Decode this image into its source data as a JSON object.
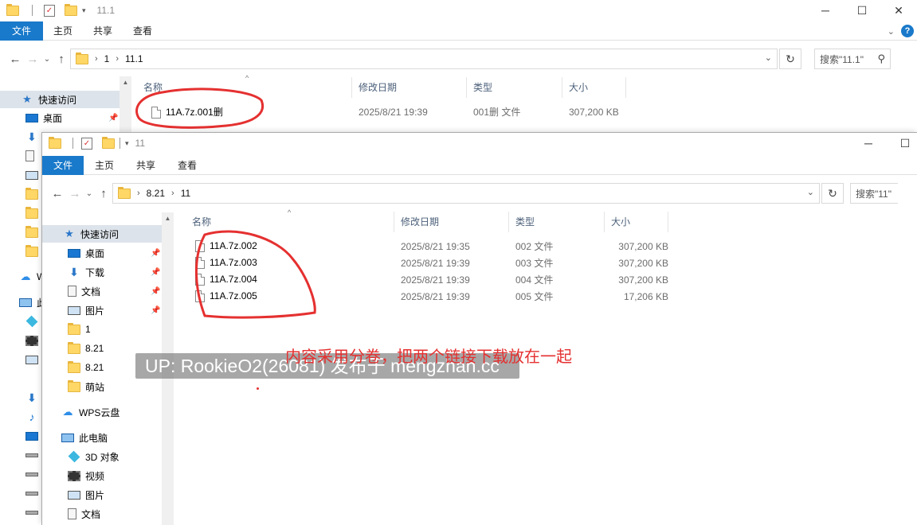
{
  "back": {
    "title": "11.1",
    "tabs": [
      "文件",
      "主页",
      "共享",
      "查看"
    ],
    "crumbs": [
      "1",
      "11.1"
    ],
    "search_placeholder": "搜索\"11.1\"",
    "columns": [
      "名称",
      "修改日期",
      "类型",
      "大小"
    ],
    "files": [
      {
        "name": "11A.7z.001删",
        "date": "2025/8/21 19:39",
        "type": "001删 文件",
        "size": "307,200 KB"
      }
    ],
    "nav": {
      "quick_access": "快速访问",
      "desktop": "桌面",
      "wps_partial": "W",
      "pc_partial": "此"
    }
  },
  "front": {
    "title": "11",
    "tabs": [
      "文件",
      "主页",
      "共享",
      "查看"
    ],
    "crumbs": [
      "8.21",
      "11"
    ],
    "search_placeholder": "搜索\"11\"",
    "columns": [
      "名称",
      "修改日期",
      "类型",
      "大小"
    ],
    "files": [
      {
        "name": "11A.7z.002",
        "date": "2025/8/21 19:35",
        "type": "002 文件",
        "size": "307,200 KB"
      },
      {
        "name": "11A.7z.003",
        "date": "2025/8/21 19:39",
        "type": "003 文件",
        "size": "307,200 KB"
      },
      {
        "name": "11A.7z.004",
        "date": "2025/8/21 19:39",
        "type": "004 文件",
        "size": "307,200 KB"
      },
      {
        "name": "11A.7z.005",
        "date": "2025/8/21 19:39",
        "type": "005 文件",
        "size": "17,206 KB"
      }
    ],
    "nav": {
      "quick_access": "快速访问",
      "desktop": "桌面",
      "downloads": "下载",
      "documents": "文档",
      "pictures": "图片",
      "f1": "1",
      "f2": "8.21",
      "f3": "8.21",
      "f4": "萌站",
      "wps": "WPS云盘",
      "pc": "此电脑",
      "obj3d": "3D 对象",
      "videos": "视频",
      "pictures2": "图片",
      "documents2": "文档"
    }
  },
  "overlay": {
    "watermark": "UP: RookieO2(26081) 发布于 mengzhan.cc",
    "annotation": "内容采用分卷，把两个链接下载放在一起"
  },
  "colors": {
    "accent": "#1979ca",
    "annotation": "#e53030",
    "selection": "#dde3ea"
  }
}
